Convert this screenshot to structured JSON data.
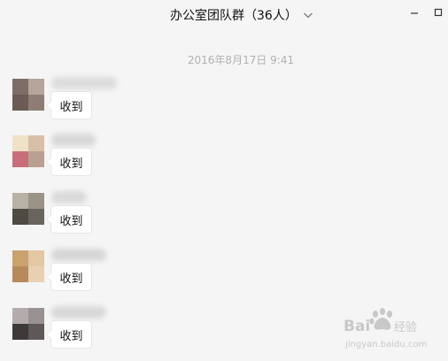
{
  "window": {
    "title": "办公室团队群（36人）",
    "chevron_icon": "chevron-down-icon",
    "minimize_icon": "minimize-icon",
    "maximize_icon": "maximize-icon"
  },
  "chat": {
    "timestamp": "2016年8月17日 9:41",
    "messages": [
      {
        "text": "收到",
        "avatar_color": "#8a7a70"
      },
      {
        "text": "收到",
        "avatar_color": "#c9a48e"
      },
      {
        "text": "收到",
        "avatar_color": "#7f7a6e"
      },
      {
        "text": "收到",
        "avatar_color": "#c7a27c"
      },
      {
        "text": "收到",
        "avatar_color": "#6e6a6a"
      }
    ]
  },
  "watermark": {
    "brand": "Bai du 经验",
    "url": "jingyan.baidu.com"
  }
}
